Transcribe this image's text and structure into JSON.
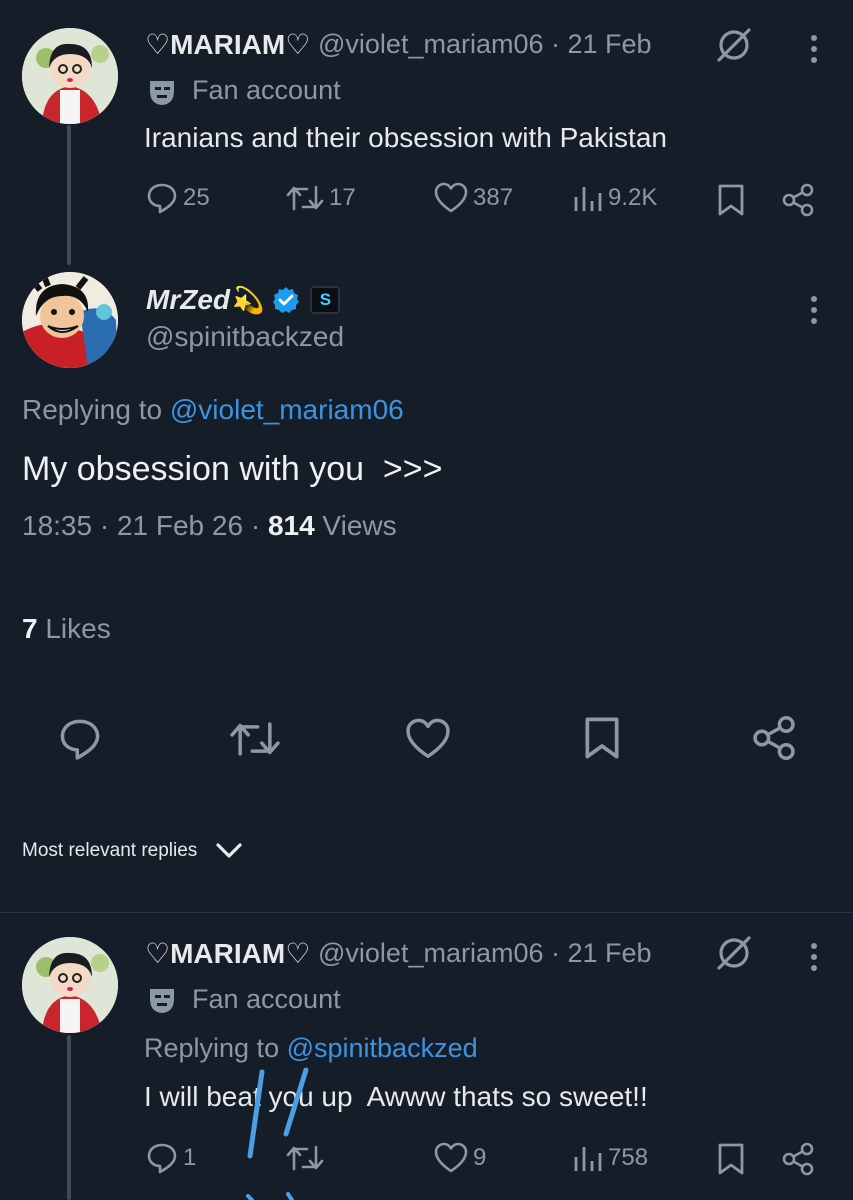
{
  "tweet1": {
    "display_name": "♡MARIAM♡",
    "handle_time": "@violet_mariam06 · 21 Feb",
    "fan_label": "Fan account",
    "text": "Iranians and their obsession with Pakistan",
    "replies": "25",
    "reposts": "17",
    "likes": "387",
    "views": "9.2K"
  },
  "tweet2": {
    "display_name": "MrZed",
    "name_emoji": "💫",
    "badge_letter": "S",
    "handle": "@spinitbackzed",
    "replying_prefix": "Replying to ",
    "replying_handle": "@violet_mariam06",
    "text": "My obsession with you  >>>",
    "timestamp": "18:35 · 21 Feb 26 · ",
    "views_count": "814",
    "views_label": " Views",
    "likes_count": "7",
    "likes_label": " Likes"
  },
  "sort": {
    "label": "Most relevant replies"
  },
  "tweet3": {
    "display_name": "♡MARIAM♡",
    "handle_time": "@violet_mariam06 · 21 Feb",
    "fan_label": "Fan account",
    "replying_prefix": "Replying to ",
    "replying_handle": "@spinitbackzed",
    "text": "I will beat you up  Awww thats so sweet!!",
    "replies": "1",
    "likes": "9",
    "views": "758"
  },
  "colors": {
    "background": "#151d28",
    "accent": "#3e93e0",
    "muted": "#8b98a5",
    "verified": "#1d9bf0"
  },
  "icons": [
    "reply-icon",
    "repost-icon",
    "like-icon",
    "views-icon",
    "bookmark-icon",
    "share-icon",
    "more-icon",
    "hidden-icon",
    "mask-icon",
    "verified-icon",
    "chevron-down-icon"
  ]
}
